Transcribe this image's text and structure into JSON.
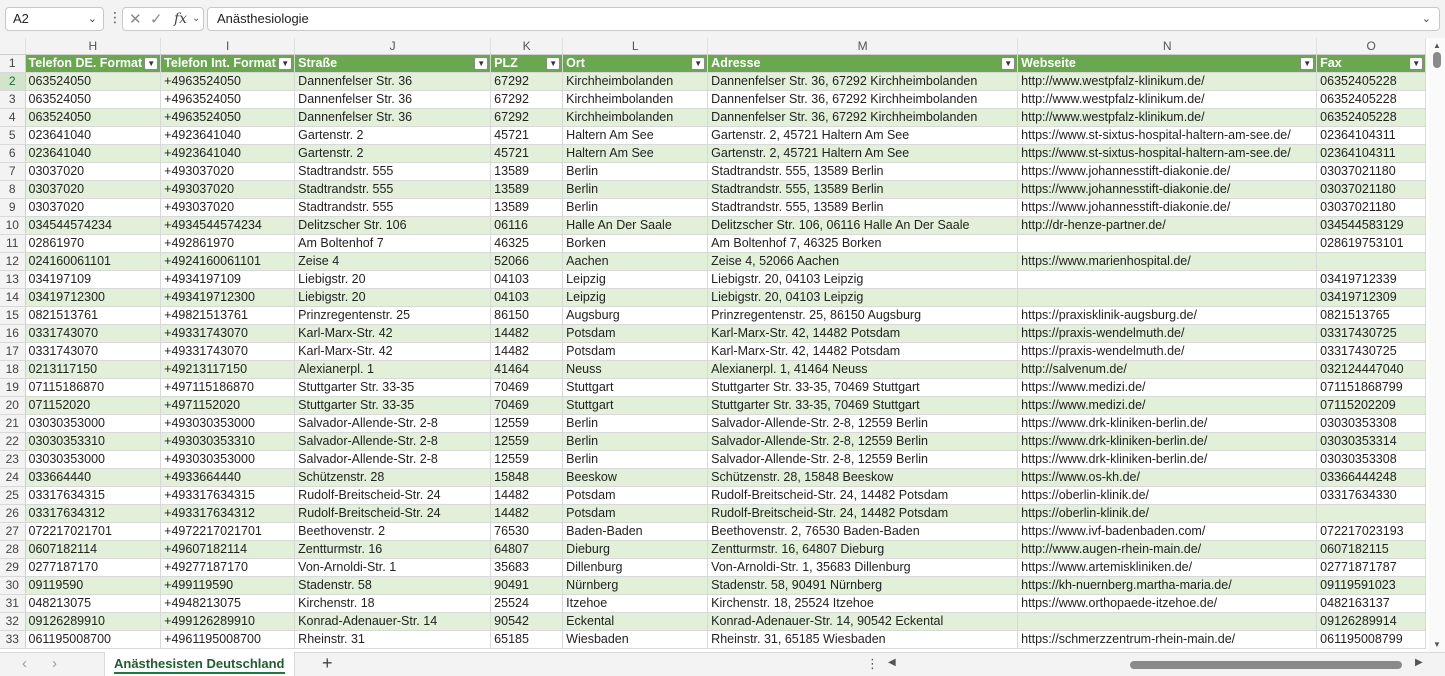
{
  "formula_bar": {
    "name_box": "A2",
    "dots": "⋮",
    "cancel_icon": "✕",
    "enter_icon": "✓",
    "fx_label": "fx",
    "formula_value": "Anästhesiologie"
  },
  "columns": [
    "H",
    "I",
    "J",
    "K",
    "L",
    "M",
    "N",
    "O"
  ],
  "header_row": {
    "row_number": "1",
    "cells": [
      "Telefon DE. Format",
      "Telefon Int. Format",
      "Straße",
      "PLZ",
      "Ort",
      "Adresse",
      "Webseite",
      "Fax"
    ]
  },
  "rows": [
    {
      "n": "2",
      "c": [
        "063524050",
        "+4963524050",
        "Dannenfelser Str. 36",
        "67292",
        "Kirchheimbolanden",
        "Dannenfelser Str. 36, 67292 Kirchheimbolanden",
        "http://www.westpfalz-klinikum.de/",
        "06352405228"
      ]
    },
    {
      "n": "3",
      "c": [
        "063524050",
        "+4963524050",
        "Dannenfelser Str. 36",
        "67292",
        "Kirchheimbolanden",
        "Dannenfelser Str. 36, 67292 Kirchheimbolanden",
        "http://www.westpfalz-klinikum.de/",
        "06352405228"
      ]
    },
    {
      "n": "4",
      "c": [
        "063524050",
        "+4963524050",
        "Dannenfelser Str. 36",
        "67292",
        "Kirchheimbolanden",
        "Dannenfelser Str. 36, 67292 Kirchheimbolanden",
        "http://www.westpfalz-klinikum.de/",
        "06352405228"
      ]
    },
    {
      "n": "5",
      "c": [
        "023641040",
        "+4923641040",
        "Gartenstr. 2",
        "45721",
        "Haltern Am See",
        "Gartenstr. 2, 45721 Haltern Am See",
        "https://www.st-sixtus-hospital-haltern-am-see.de/",
        "02364104311"
      ]
    },
    {
      "n": "6",
      "c": [
        "023641040",
        "+4923641040",
        "Gartenstr. 2",
        "45721",
        "Haltern Am See",
        "Gartenstr. 2, 45721 Haltern Am See",
        "https://www.st-sixtus-hospital-haltern-am-see.de/",
        "02364104311"
      ]
    },
    {
      "n": "7",
      "c": [
        "03037020",
        "+493037020",
        "Stadtrandstr. 555",
        "13589",
        "Berlin",
        "Stadtrandstr. 555, 13589 Berlin",
        "https://www.johannesstift-diakonie.de/",
        "03037021180"
      ]
    },
    {
      "n": "8",
      "c": [
        "03037020",
        "+493037020",
        "Stadtrandstr. 555",
        "13589",
        "Berlin",
        "Stadtrandstr. 555, 13589 Berlin",
        "https://www.johannesstift-diakonie.de/",
        "03037021180"
      ]
    },
    {
      "n": "9",
      "c": [
        "03037020",
        "+493037020",
        "Stadtrandstr. 555",
        "13589",
        "Berlin",
        "Stadtrandstr. 555, 13589 Berlin",
        "https://www.johannesstift-diakonie.de/",
        "03037021180"
      ]
    },
    {
      "n": "10",
      "c": [
        "034544574234",
        "+4934544574234",
        "Delitzscher Str. 106",
        "06116",
        "Halle An Der Saale",
        "Delitzscher Str. 106, 06116 Halle An Der Saale",
        "http://dr-henze-partner.de/",
        "034544583129"
      ]
    },
    {
      "n": "11",
      "c": [
        "02861970",
        "+492861970",
        "Am Boltenhof 7",
        "46325",
        "Borken",
        "Am Boltenhof 7, 46325 Borken",
        "",
        "028619753101"
      ]
    },
    {
      "n": "12",
      "c": [
        "024160061101",
        "+4924160061101",
        "Zeise 4",
        "52066",
        "Aachen",
        "Zeise 4, 52066 Aachen",
        "https://www.marienhospital.de/",
        ""
      ]
    },
    {
      "n": "13",
      "c": [
        "034197109",
        "+4934197109",
        "Liebigstr. 20",
        "04103",
        "Leipzig",
        "Liebigstr. 20, 04103 Leipzig",
        "",
        "03419712339"
      ]
    },
    {
      "n": "14",
      "c": [
        "03419712300",
        "+493419712300",
        "Liebigstr. 20",
        "04103",
        "Leipzig",
        "Liebigstr. 20, 04103 Leipzig",
        "",
        "03419712309"
      ]
    },
    {
      "n": "15",
      "c": [
        "0821513761",
        "+49821513761",
        "Prinzregentenstr. 25",
        "86150",
        "Augsburg",
        "Prinzregentenstr. 25, 86150 Augsburg",
        "https://praxisklinik-augsburg.de/",
        "0821513765"
      ]
    },
    {
      "n": "16",
      "c": [
        "0331743070",
        "+49331743070",
        "Karl-Marx-Str. 42",
        "14482",
        "Potsdam",
        "Karl-Marx-Str. 42, 14482 Potsdam",
        "https://praxis-wendelmuth.de/",
        "03317430725"
      ]
    },
    {
      "n": "17",
      "c": [
        "0331743070",
        "+49331743070",
        "Karl-Marx-Str. 42",
        "14482",
        "Potsdam",
        "Karl-Marx-Str. 42, 14482 Potsdam",
        "https://praxis-wendelmuth.de/",
        "03317430725"
      ]
    },
    {
      "n": "18",
      "c": [
        "0213117150",
        "+49213117150",
        "Alexianerpl. 1",
        "41464",
        "Neuss",
        "Alexianerpl. 1, 41464 Neuss",
        "http://salvenum.de/",
        "032124447040"
      ]
    },
    {
      "n": "19",
      "c": [
        "07115186870",
        "+497115186870",
        "Stuttgarter Str. 33-35",
        "70469",
        "Stuttgart",
        "Stuttgarter Str. 33-35, 70469 Stuttgart",
        "https://www.medizi.de/",
        "071151868799"
      ]
    },
    {
      "n": "20",
      "c": [
        "071152020",
        "+4971152020",
        "Stuttgarter Str. 33-35",
        "70469",
        "Stuttgart",
        "Stuttgarter Str. 33-35, 70469 Stuttgart",
        "https://www.medizi.de/",
        "07115202209"
      ]
    },
    {
      "n": "21",
      "c": [
        "03030353000",
        "+493030353000",
        "Salvador-Allende-Str. 2-8",
        "12559",
        "Berlin",
        "Salvador-Allende-Str. 2-8, 12559 Berlin",
        "https://www.drk-kliniken-berlin.de/",
        "03030353308"
      ]
    },
    {
      "n": "22",
      "c": [
        "03030353310",
        "+493030353310",
        "Salvador-Allende-Str. 2-8",
        "12559",
        "Berlin",
        "Salvador-Allende-Str. 2-8, 12559 Berlin",
        "https://www.drk-kliniken-berlin.de/",
        "03030353314"
      ]
    },
    {
      "n": "23",
      "c": [
        "03030353000",
        "+493030353000",
        "Salvador-Allende-Str. 2-8",
        "12559",
        "Berlin",
        "Salvador-Allende-Str. 2-8, 12559 Berlin",
        "https://www.drk-kliniken-berlin.de/",
        "03030353308"
      ]
    },
    {
      "n": "24",
      "c": [
        "033664440",
        "+4933664440",
        "Schützenstr. 28",
        "15848",
        "Beeskow",
        "Schützenstr. 28, 15848 Beeskow",
        "https://www.os-kh.de/",
        "03366444248"
      ]
    },
    {
      "n": "25",
      "c": [
        "03317634315",
        "+493317634315",
        "Rudolf-Breitscheid-Str. 24",
        "14482",
        "Potsdam",
        "Rudolf-Breitscheid-Str. 24, 14482 Potsdam",
        "https://oberlin-klinik.de/",
        "03317634330"
      ]
    },
    {
      "n": "26",
      "c": [
        "03317634312",
        "+493317634312",
        "Rudolf-Breitscheid-Str. 24",
        "14482",
        "Potsdam",
        "Rudolf-Breitscheid-Str. 24, 14482 Potsdam",
        "https://oberlin-klinik.de/",
        ""
      ]
    },
    {
      "n": "27",
      "c": [
        "072217021701",
        "+4972217021701",
        "Beethovenstr. 2",
        "76530",
        "Baden-Baden",
        "Beethovenstr. 2, 76530 Baden-Baden",
        "https://www.ivf-badenbaden.com/",
        "072217023193"
      ]
    },
    {
      "n": "28",
      "c": [
        "0607182114",
        "+49607182114",
        "Zentturmstr. 16",
        "64807",
        "Dieburg",
        "Zentturmstr. 16, 64807 Dieburg",
        "http://www.augen-rhein-main.de/",
        "0607182115"
      ]
    },
    {
      "n": "29",
      "c": [
        "0277187170",
        "+49277187170",
        "Von-Arnoldi-Str. 1",
        "35683",
        "Dillenburg",
        "Von-Arnoldi-Str. 1, 35683 Dillenburg",
        "https://www.artemiskliniken.de/",
        "02771871787"
      ]
    },
    {
      "n": "30",
      "c": [
        "09119590",
        "+499119590",
        "Stadenstr. 58",
        "90491",
        "Nürnberg",
        "Stadenstr. 58, 90491 Nürnberg",
        "https://kh-nuernberg.martha-maria.de/",
        "09119591023"
      ]
    },
    {
      "n": "31",
      "c": [
        "048213075",
        "+4948213075",
        "Kirchenstr. 18",
        "25524",
        "Itzehoe",
        "Kirchenstr. 18, 25524 Itzehoe",
        "https://www.orthopaede-itzehoe.de/",
        "0482163137"
      ]
    },
    {
      "n": "32",
      "c": [
        "09126289910",
        "+499126289910",
        "Konrad-Adenauer-Str. 14",
        "90542",
        "Eckental",
        "Konrad-Adenauer-Str. 14, 90542 Eckental",
        "",
        "09126289914"
      ]
    },
    {
      "n": "33",
      "c": [
        "061195008700",
        "+4961195008700",
        "Rheinstr. 31",
        "65185",
        "Wiesbaden",
        "Rheinstr. 31, 65185 Wiesbaden",
        "https://schmerzzentrum-rhein-main.de/",
        "061195008799"
      ]
    }
  ],
  "sheet_tabs": {
    "active": "Anästhesisten Deutschland",
    "add_icon": "+",
    "prev_icon": "‹",
    "next_icon": "›",
    "more_icon": "⋮"
  },
  "colors": {
    "header_fill": "#6aa84f",
    "band_fill": "#e2efd9",
    "tab_accent": "#1f7a3a"
  }
}
